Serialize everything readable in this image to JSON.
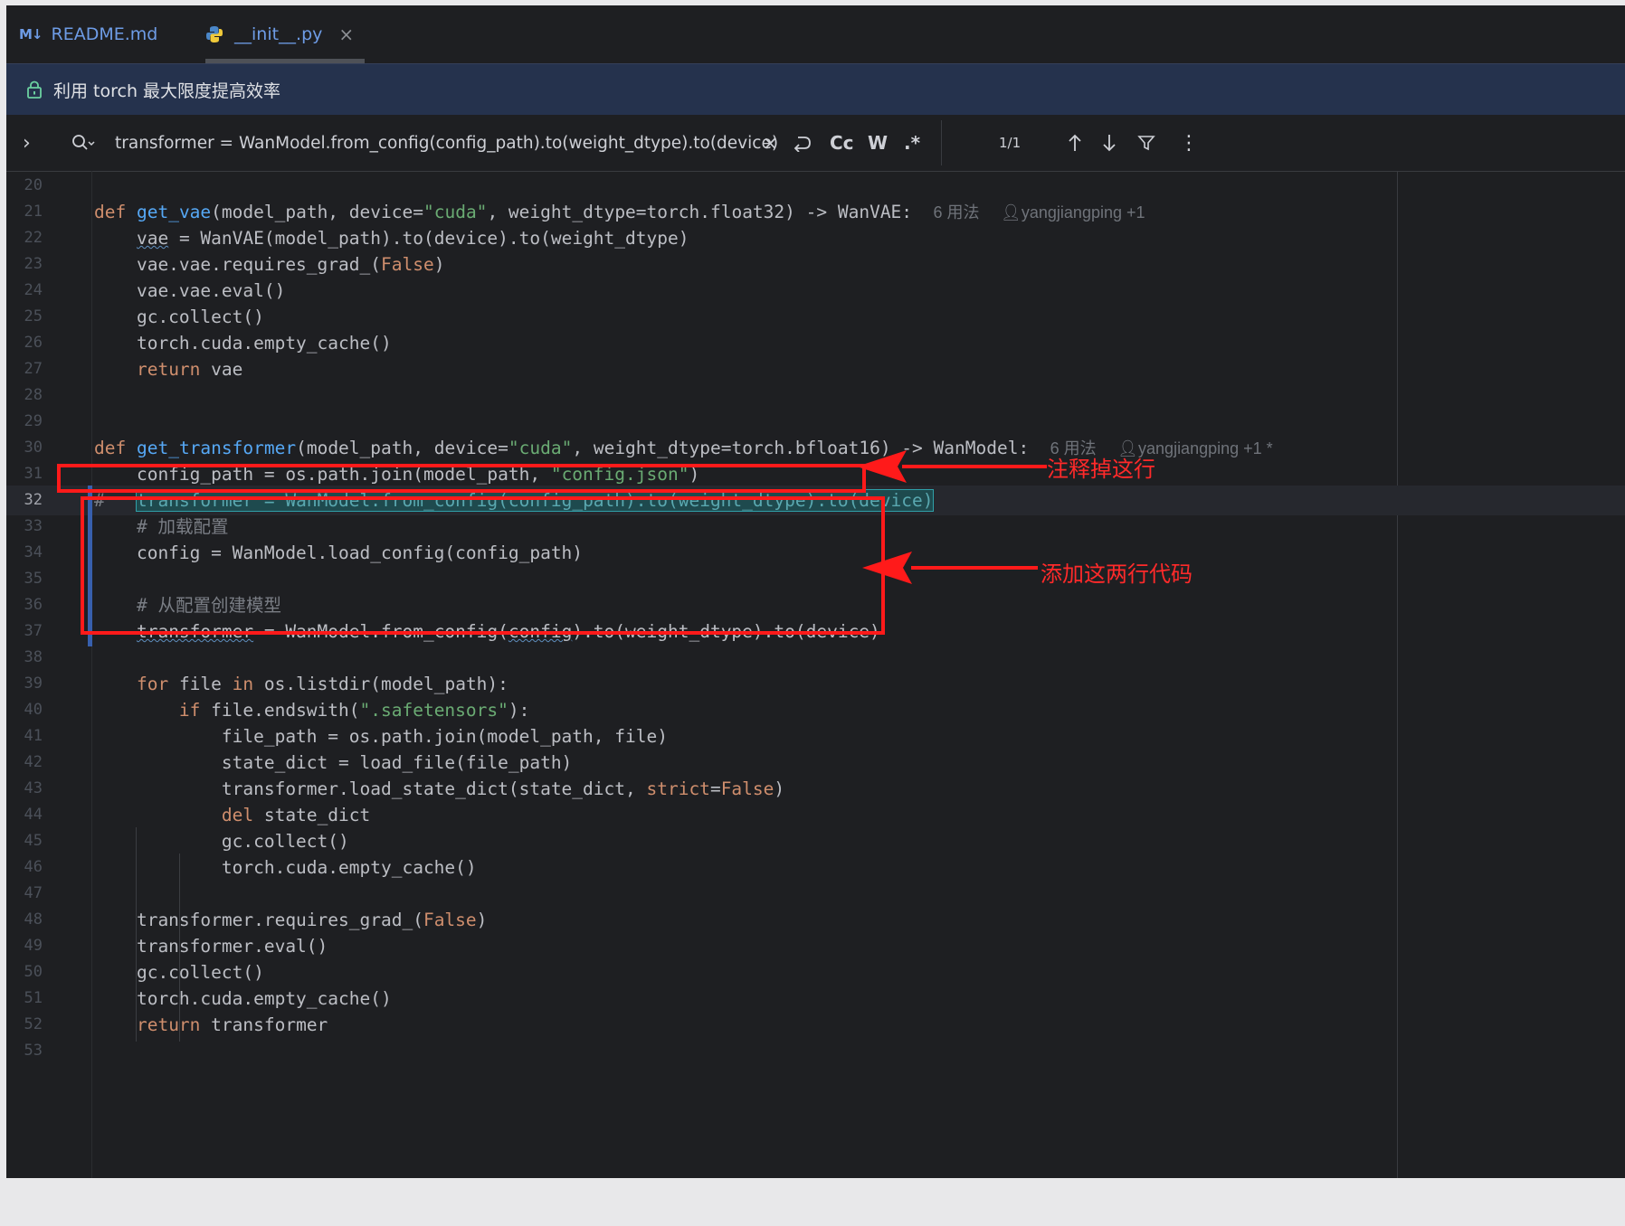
{
  "tabs": [
    {
      "icon": "markdown-icon",
      "icon_text": "M↓",
      "label": "README.md",
      "active": false
    },
    {
      "icon": "python-icon",
      "label": "__init__.py",
      "active": true,
      "close": "×"
    }
  ],
  "banner": {
    "icon": "lock-icon",
    "text": "利用 torch 最大限度提高效率"
  },
  "search": {
    "value": "transformer = WanModel.from_config(config_path).to(weight_dtype).to(device)",
    "clear": "×",
    "case": "Cc",
    "word": "W",
    "regex": ".*",
    "match_count": "1/1",
    "more": "⋮",
    "expand": "›"
  },
  "editor": {
    "current_line": "32",
    "lines": [
      {
        "n": "20"
      },
      {
        "n": "21"
      },
      {
        "n": "22"
      },
      {
        "n": "23"
      },
      {
        "n": "24"
      },
      {
        "n": "25"
      },
      {
        "n": "26"
      },
      {
        "n": "27"
      },
      {
        "n": "28"
      },
      {
        "n": "29"
      },
      {
        "n": "30"
      },
      {
        "n": "31"
      },
      {
        "n": "32"
      },
      {
        "n": "33"
      },
      {
        "n": "34"
      },
      {
        "n": "35"
      },
      {
        "n": "36"
      },
      {
        "n": "37"
      },
      {
        "n": "38"
      },
      {
        "n": "39"
      },
      {
        "n": "40"
      },
      {
        "n": "41"
      },
      {
        "n": "42"
      },
      {
        "n": "43"
      },
      {
        "n": "44"
      },
      {
        "n": "45"
      },
      {
        "n": "46"
      },
      {
        "n": "47"
      },
      {
        "n": "48"
      },
      {
        "n": "49"
      },
      {
        "n": "50"
      },
      {
        "n": "51"
      },
      {
        "n": "52"
      },
      {
        "n": "53"
      }
    ],
    "hints": {
      "vae_usages": "6 用法",
      "vae_author": "yangjiangping +1",
      "transformer_usages": "6 用法",
      "transformer_author": "yangjiangping +1 *"
    }
  },
  "annotations": {
    "comment_out": "注释掉这行",
    "add_lines": "添加这两行代码"
  }
}
